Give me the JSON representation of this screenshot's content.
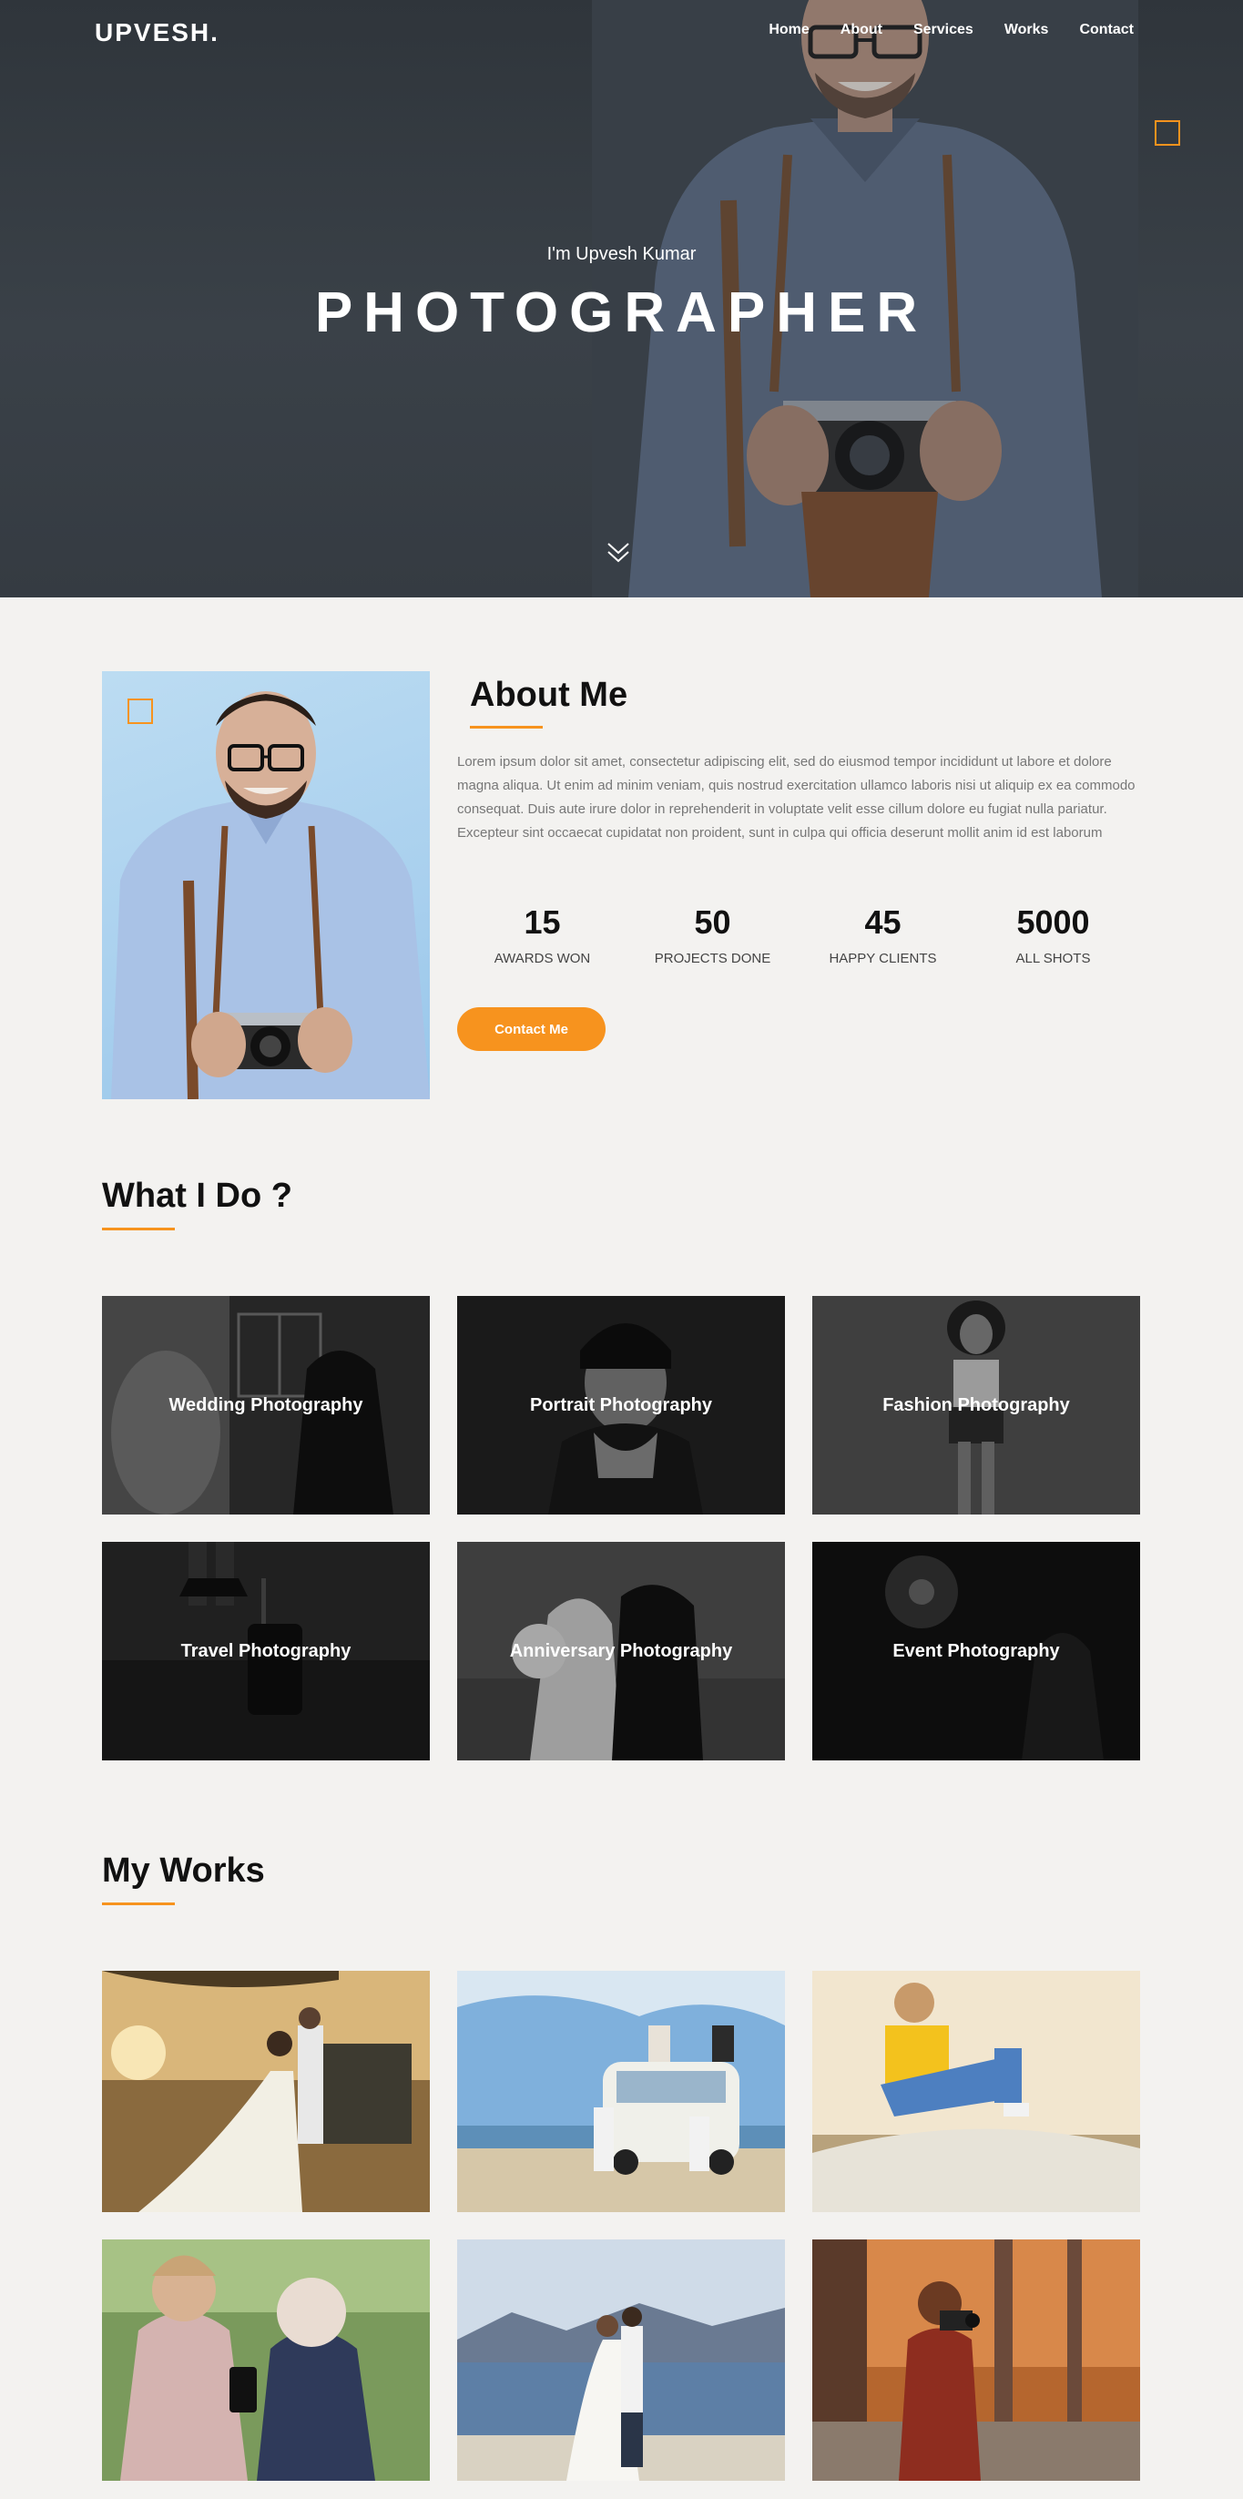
{
  "header": {
    "logo": "UPVESH.",
    "nav": [
      "Home",
      "About",
      "Services",
      "Works",
      "Contact"
    ]
  },
  "hero": {
    "intro": "I'm Upvesh Kumar",
    "title": "PHOTOGRAPHER",
    "scroll_icon": "double-chevron-down-icon"
  },
  "about": {
    "heading": "About Me",
    "text": "Lorem ipsum dolor sit amet, consectetur adipiscing elit, sed do eiusmod tempor incididunt ut labore et dolore magna aliqua. Ut enim ad minim veniam, quis nostrud exercitation ullamco laboris nisi ut aliquip ex ea commodo consequat. Duis aute irure dolor in reprehenderit in voluptate velit esse cillum dolore eu fugiat nulla pariatur. Excepteur sint occaecat cupidatat non proident, sunt in culpa qui officia deserunt mollit anim id est laborum",
    "stats": [
      {
        "value": "15",
        "label": "AWARDS WON"
      },
      {
        "value": "50",
        "label": "PROJECTS DONE"
      },
      {
        "value": "45",
        "label": "HAPPY CLIENTS"
      },
      {
        "value": "5000",
        "label": "ALL SHOTS"
      }
    ],
    "button": "Contact Me"
  },
  "services": {
    "heading": "What I Do ?",
    "items": [
      "Wedding Photography",
      "Portrait Photography",
      "Fashion Photography",
      "Travel Photography",
      "Anniversary Photography",
      "Event Photography"
    ]
  },
  "works": {
    "heading": "My Works"
  },
  "colors": {
    "accent": "#f7931e",
    "page_bg": "#f3f2f0",
    "hero_bg": "#363c43"
  }
}
